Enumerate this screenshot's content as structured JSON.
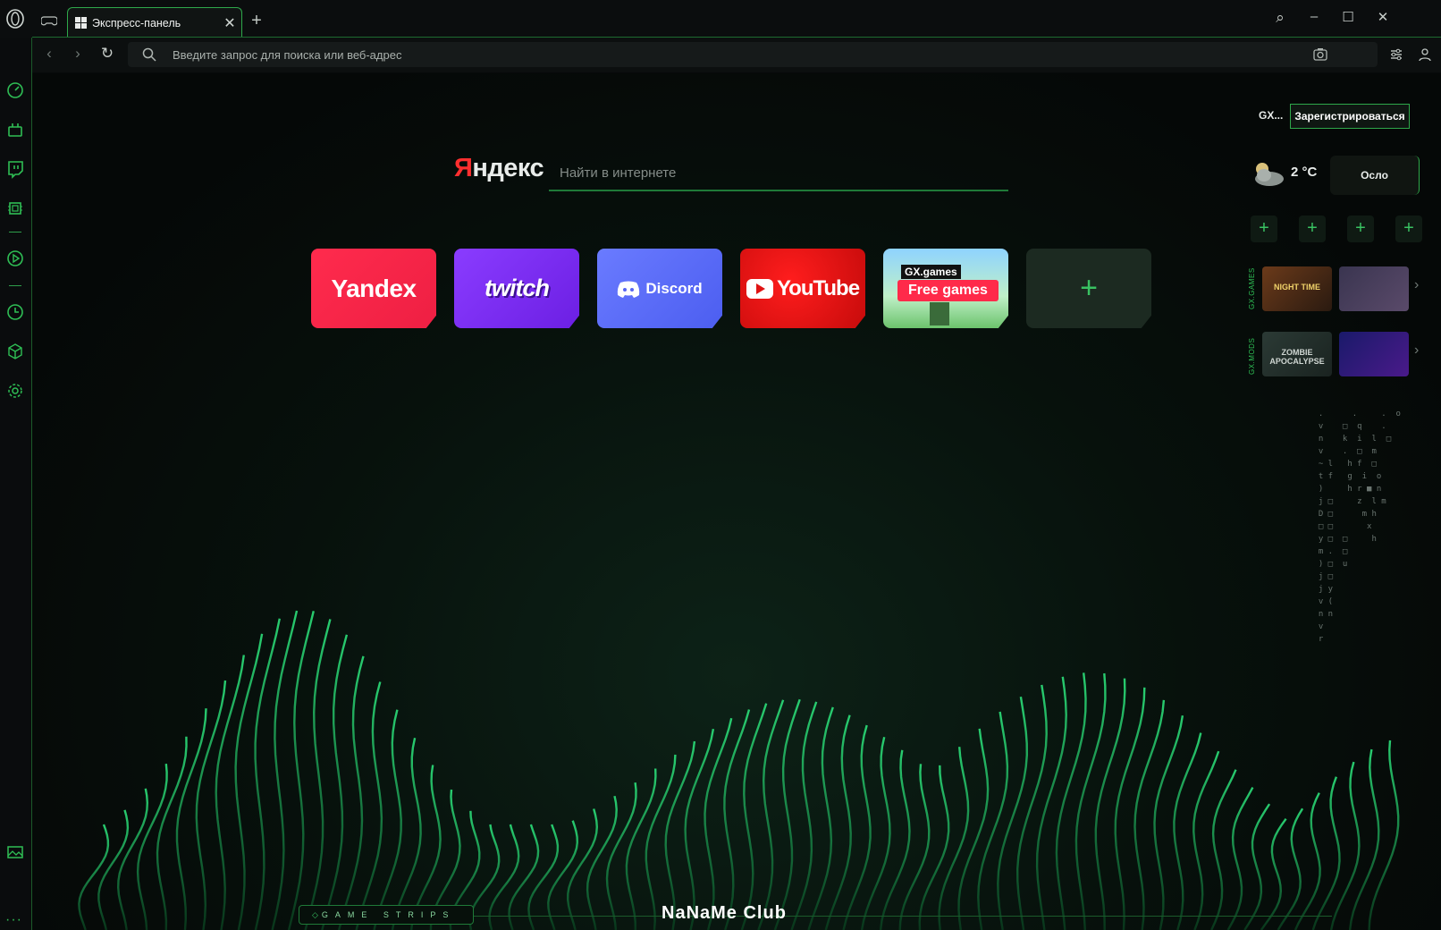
{
  "tab": {
    "title": "Экспресс-панель",
    "close": "✕",
    "new": "+"
  },
  "window": {
    "search": "⌕",
    "minimize": "–",
    "maximize": "☐",
    "close": "✕"
  },
  "nav": {
    "back": "‹",
    "forward": "›",
    "reload": "↻"
  },
  "address": {
    "placeholder": "Введите запрос для поиска или веб-адрес"
  },
  "search": {
    "logo_first": "Я",
    "logo_rest": "ндекс",
    "placeholder": "Найти в интернете"
  },
  "dials": {
    "yandex": "Yandex",
    "twitch": "twitch",
    "discord": "Discord",
    "youtube": "YouTube",
    "gx_tag": "GX.games",
    "gx_free": "Free games",
    "add": "+"
  },
  "account": {
    "gx_label": "GX...",
    "register": "Зарегистрироваться"
  },
  "weather": {
    "temp": "2 °C",
    "city": "Осло"
  },
  "widgets": {
    "plus": "+"
  },
  "strips": {
    "games_label": "GX.GAMES",
    "mods_label": "GX.MODS",
    "game1": "NIGHT TIME",
    "game2": "",
    "mod1": "ZOMBIE APOCALYPSE",
    "mod2": "",
    "arrow": "›"
  },
  "bottom": {
    "game_strips": "GAME STRIPS",
    "diamond": "◇",
    "watermark": "NaNaMe Club"
  },
  "sidebar_more": "···",
  "colors": {
    "accent": "#2fbf55",
    "yandex": "#ff2b4d",
    "twitch": "#8a3cff",
    "discord": "#5865f2",
    "youtube": "#ff0000"
  }
}
